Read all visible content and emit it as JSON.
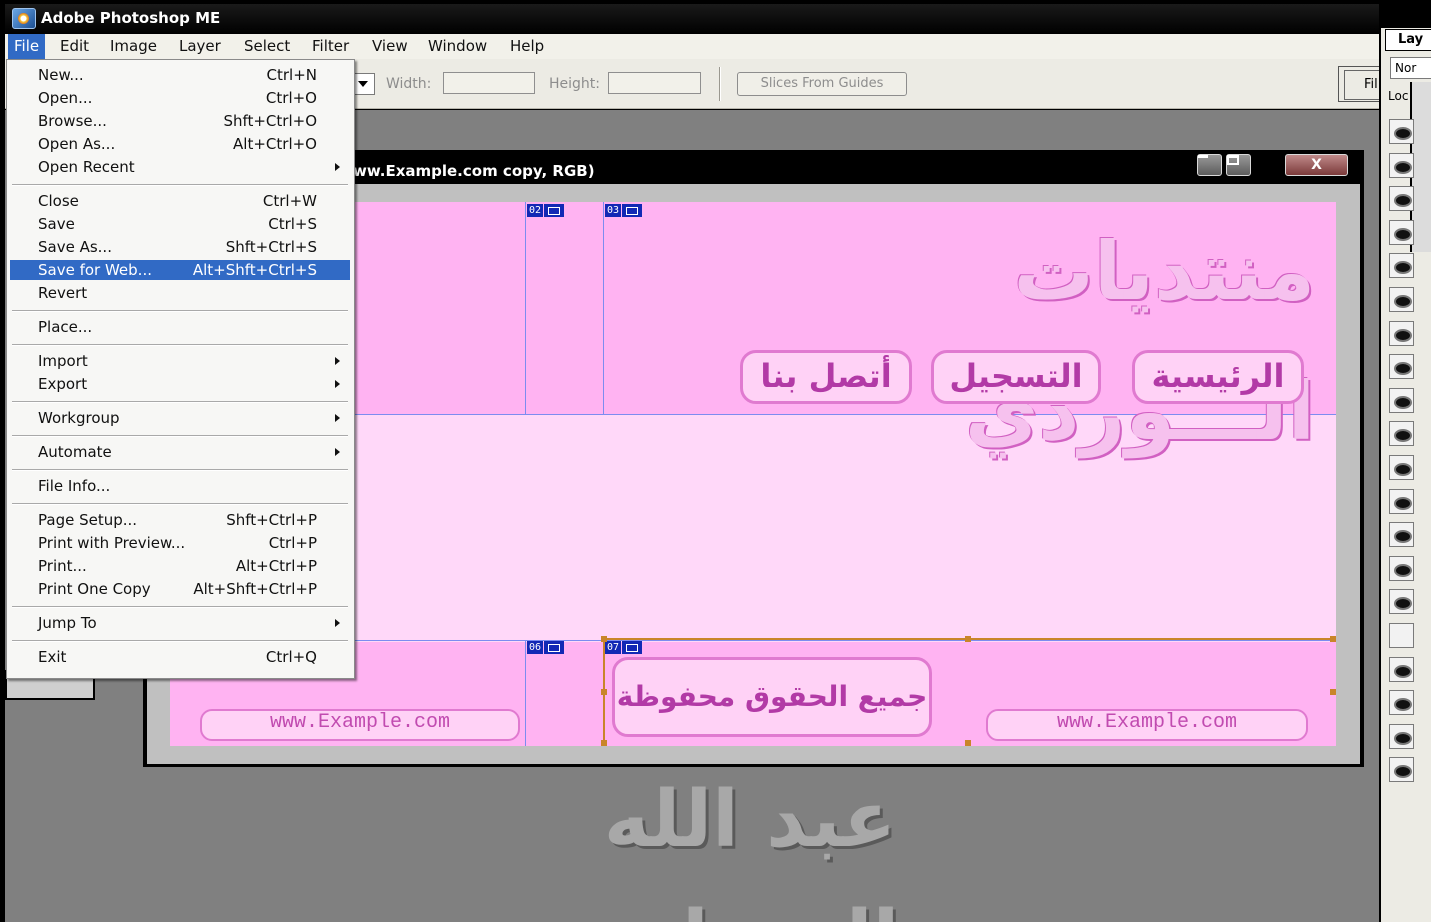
{
  "app": {
    "title": "Adobe Photoshop ME"
  },
  "menubar": [
    {
      "label": "File",
      "active": true
    },
    {
      "label": "Edit"
    },
    {
      "label": "Image"
    },
    {
      "label": "Layer"
    },
    {
      "label": "Select"
    },
    {
      "label": "Filter"
    },
    {
      "label": "View"
    },
    {
      "label": "Window"
    },
    {
      "label": "Help"
    }
  ],
  "options": {
    "width_label": "Width:",
    "height_label": "Height:",
    "slices_button": "Slices From Guides",
    "palette_well_label": "Fil"
  },
  "file_menu": {
    "groups": [
      [
        {
          "label": "New...",
          "shortcut": "Ctrl+N"
        },
        {
          "label": "Open...",
          "shortcut": "Ctrl+O"
        },
        {
          "label": "Browse...",
          "shortcut": "Shft+Ctrl+O"
        },
        {
          "label": "Open As...",
          "shortcut": "Alt+Ctrl+O"
        },
        {
          "label": "Open Recent",
          "shortcut": "",
          "submenu": true
        }
      ],
      [
        {
          "label": "Close",
          "shortcut": "Ctrl+W"
        },
        {
          "label": "Save",
          "shortcut": "Ctrl+S"
        },
        {
          "label": "Save As...",
          "shortcut": "Shft+Ctrl+S"
        },
        {
          "label": "Save for Web...",
          "shortcut": "Alt+Shft+Ctrl+S",
          "highlighted": true
        },
        {
          "label": "Revert",
          "shortcut": ""
        }
      ],
      [
        {
          "label": "Place...",
          "shortcut": ""
        }
      ],
      [
        {
          "label": "Import",
          "shortcut": "",
          "submenu": true
        },
        {
          "label": "Export",
          "shortcut": "",
          "submenu": true
        }
      ],
      [
        {
          "label": "Workgroup",
          "shortcut": "",
          "submenu": true
        }
      ],
      [
        {
          "label": "Automate",
          "shortcut": "",
          "submenu": true
        }
      ],
      [
        {
          "label": "File Info...",
          "shortcut": ""
        }
      ],
      [
        {
          "label": "Page Setup...",
          "shortcut": "Shft+Ctrl+P"
        },
        {
          "label": "Print with Preview...",
          "shortcut": "Ctrl+P"
        },
        {
          "label": "Print...",
          "shortcut": "Alt+Ctrl+P"
        },
        {
          "label": "Print One Copy",
          "shortcut": "Alt+Shft+Ctrl+P"
        }
      ],
      [
        {
          "label": "Jump To",
          "shortcut": "",
          "submenu": true
        }
      ],
      [
        {
          "label": "Exit",
          "shortcut": "Ctrl+Q"
        }
      ]
    ]
  },
  "document": {
    "title": "ww.Example.com copy, RGB)",
    "close_glyph": "X",
    "slices": [
      "02",
      "03",
      "06",
      "07"
    ],
    "site_name": "منتديات الـــوردي",
    "nav_buttons": [
      "الرئيسية",
      "التسجيل",
      "أتصل بنا"
    ],
    "footer_left_url": "www.Example.com",
    "footer_right_url": "www.Example.com",
    "footer_rights": "جميع الحقوق محفوظة"
  },
  "signature": "عبد الله العجيلي",
  "layers_panel": {
    "tab_label": "Lay",
    "blend_mode": "Nor",
    "lock_label": "Loc",
    "eye_states": [
      true,
      true,
      true,
      true,
      true,
      true,
      true,
      true,
      true,
      true,
      true,
      true,
      true,
      true,
      true,
      false,
      true,
      true,
      true,
      true
    ]
  },
  "colors": {
    "highlight": "#316ac5",
    "canvas_pink": "#ffb3f2",
    "slice_blue": "#1228b5"
  }
}
